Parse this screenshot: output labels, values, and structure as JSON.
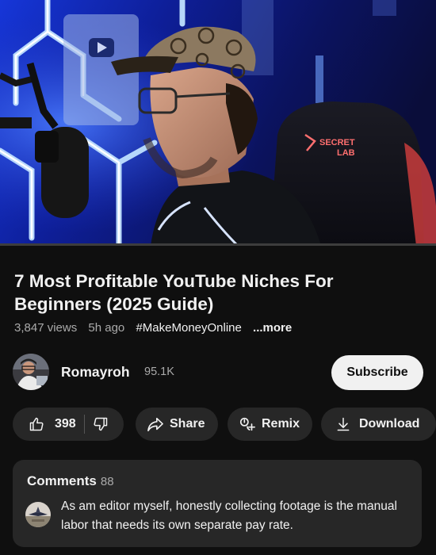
{
  "player": {
    "progress_percent": 0,
    "chair_brand": "SECRET",
    "chair_brand_2": "LAB"
  },
  "video": {
    "title": "7 Most Profitable YouTube Niches For Beginners (2025 Guide)",
    "views": "3,847 views",
    "age": "5h ago",
    "hashtag": "#MakeMoneyOnline",
    "more_label": "...more"
  },
  "channel": {
    "name": "Romayroh",
    "subscribers": "95.1K",
    "subscribe_label": "Subscribe"
  },
  "actions": {
    "like_count": "398",
    "share_label": "Share",
    "remix_label": "Remix",
    "download_label": "Download"
  },
  "comments": {
    "label": "Comments",
    "count": "88",
    "top_comment": "As am editor myself, honestly collecting footage is the manual labor that needs its own separate pay rate."
  },
  "colors": {
    "background": "#0f0f0f",
    "pill": "#272727",
    "subscribe_bg": "#f1f1f1",
    "neon_blue": "#2a5cff"
  },
  "icons": [
    "like-icon",
    "dislike-icon",
    "share-icon",
    "remix-icon",
    "download-icon"
  ]
}
